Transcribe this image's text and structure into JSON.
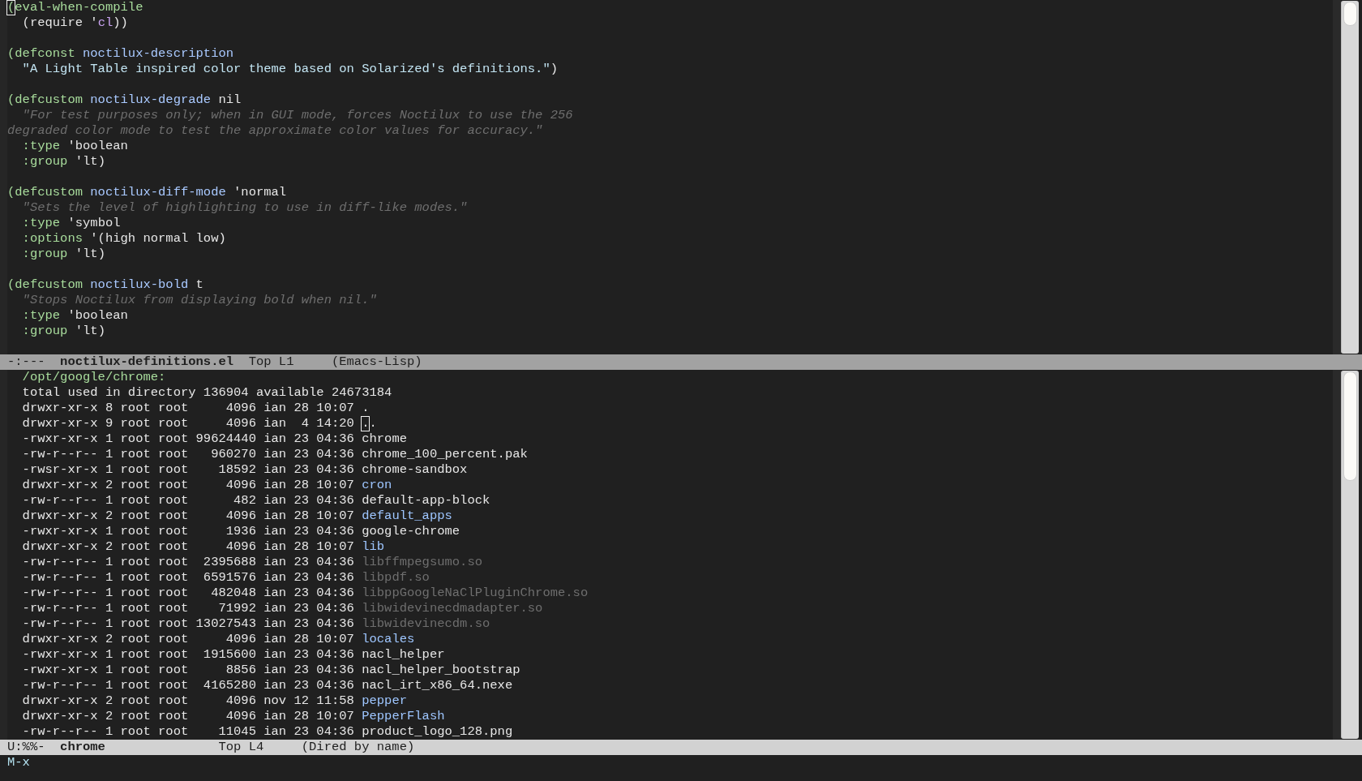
{
  "code_window": {
    "lines": [
      {
        "segments": [
          {
            "kind": "keyword",
            "text": "(eval-when-compile",
            "cursor": true
          }
        ]
      },
      {
        "segments": [
          {
            "kind": "plain",
            "text": "  (require '"
          },
          {
            "kind": "symbol",
            "text": "cl"
          },
          {
            "kind": "plain",
            "text": "))"
          }
        ]
      },
      {
        "blank_before": true,
        "segments": [
          {
            "kind": "keyword",
            "text": "(defconst"
          },
          {
            "kind": "name",
            "text": " noctilux-description"
          }
        ]
      },
      {
        "segments": [
          {
            "kind": "string",
            "text": "  \"A Light Table inspired color theme based on Solarized's definitions.\""
          },
          {
            "kind": "plain",
            "text": ")"
          }
        ]
      },
      {
        "blank_before": true,
        "segments": [
          {
            "kind": "keyword",
            "text": "(defcustom"
          },
          {
            "kind": "name",
            "text": " noctilux-degrade"
          },
          {
            "kind": "plain",
            "text": " nil"
          }
        ]
      },
      {
        "segments": [
          {
            "kind": "doc",
            "text": "  \"For test purposes only; when in GUI mode, forces Noctilux to use the 256"
          }
        ]
      },
      {
        "segments": [
          {
            "kind": "doc",
            "text": "degraded color mode to test the approximate color values for accuracy.\""
          }
        ]
      },
      {
        "segments": [
          {
            "kind": "keyword",
            "text": "  :type"
          },
          {
            "kind": "plain",
            "text": " 'boolean"
          }
        ]
      },
      {
        "segments": [
          {
            "kind": "keyword",
            "text": "  :group"
          },
          {
            "kind": "plain",
            "text": " 'lt)"
          }
        ]
      },
      {
        "blank_before": true,
        "segments": [
          {
            "kind": "keyword",
            "text": "(defcustom"
          },
          {
            "kind": "name",
            "text": " noctilux-diff-mode"
          },
          {
            "kind": "plain",
            "text": " 'normal"
          }
        ]
      },
      {
        "segments": [
          {
            "kind": "doc",
            "text": "  \"Sets the level of highlighting to use in diff-like modes.\""
          }
        ]
      },
      {
        "segments": [
          {
            "kind": "keyword",
            "text": "  :type"
          },
          {
            "kind": "plain",
            "text": " 'symbol"
          }
        ]
      },
      {
        "segments": [
          {
            "kind": "keyword",
            "text": "  :options"
          },
          {
            "kind": "plain",
            "text": " '(high normal low)"
          }
        ]
      },
      {
        "segments": [
          {
            "kind": "keyword",
            "text": "  :group"
          },
          {
            "kind": "plain",
            "text": " 'lt)"
          }
        ]
      },
      {
        "blank_before": true,
        "segments": [
          {
            "kind": "keyword",
            "text": "(defcustom"
          },
          {
            "kind": "name",
            "text": " noctilux-bold"
          },
          {
            "kind": "plain",
            "text": " t"
          }
        ]
      },
      {
        "segments": [
          {
            "kind": "doc",
            "text": "  \"Stops Noctilux from displaying bold when nil.\""
          }
        ]
      },
      {
        "segments": [
          {
            "kind": "keyword",
            "text": "  :type"
          },
          {
            "kind": "plain",
            "text": " 'boolean"
          }
        ]
      },
      {
        "segments": [
          {
            "kind": "keyword",
            "text": "  :group"
          },
          {
            "kind": "plain",
            "text": " 'lt)"
          }
        ]
      }
    ],
    "mode_line": {
      "active": false,
      "status": "-:---",
      "buffer": "noctilux-definitions.el",
      "position": "Top L1",
      "mode": "(Emacs-Lisp)"
    }
  },
  "dired_window": {
    "header": "  /opt/google/chrome:",
    "total": "  total used in directory 136904 available 24673184",
    "rows": [
      {
        "info": "  drwxr-xr-x 8 root root     4096 ian 28 10:07 ",
        "name": ".",
        "kind": "file"
      },
      {
        "info": "  drwxr-xr-x 9 root root     4096 ian  4 14:20 ",
        "name": "..",
        "kind": "file",
        "cursor": true
      },
      {
        "info": "  -rwxr-xr-x 1 root root 99624440 ian 23 04:36 ",
        "name": "chrome",
        "kind": "file"
      },
      {
        "info": "  -rw-r--r-- 1 root root   960270 ian 23 04:36 ",
        "name": "chrome_100_percent.pak",
        "kind": "file"
      },
      {
        "info": "  -rwsr-xr-x 1 root root    18592 ian 23 04:36 ",
        "name": "chrome-sandbox",
        "kind": "file"
      },
      {
        "info": "  drwxr-xr-x 2 root root     4096 ian 28 10:07 ",
        "name": "cron",
        "kind": "dir"
      },
      {
        "info": "  -rw-r--r-- 1 root root      482 ian 23 04:36 ",
        "name": "default-app-block",
        "kind": "file"
      },
      {
        "info": "  drwxr-xr-x 2 root root     4096 ian 28 10:07 ",
        "name": "default_apps",
        "kind": "dir"
      },
      {
        "info": "  -rwxr-xr-x 1 root root     1936 ian 23 04:36 ",
        "name": "google-chrome",
        "kind": "file"
      },
      {
        "info": "  drwxr-xr-x 2 root root     4096 ian 28 10:07 ",
        "name": "lib",
        "kind": "dir"
      },
      {
        "info": "  -rw-r--r-- 1 root root  2395688 ian 23 04:36 ",
        "name": "libffmpegsumo.so",
        "kind": "lib"
      },
      {
        "info": "  -rw-r--r-- 1 root root  6591576 ian 23 04:36 ",
        "name": "libpdf.so",
        "kind": "lib"
      },
      {
        "info": "  -rw-r--r-- 1 root root   482048 ian 23 04:36 ",
        "name": "libppGoogleNaClPluginChrome.so",
        "kind": "lib"
      },
      {
        "info": "  -rw-r--r-- 1 root root    71992 ian 23 04:36 ",
        "name": "libwidevinecdmadapter.so",
        "kind": "lib"
      },
      {
        "info": "  -rw-r--r-- 1 root root 13027543 ian 23 04:36 ",
        "name": "libwidevinecdm.so",
        "kind": "lib"
      },
      {
        "info": "  drwxr-xr-x 2 root root     4096 ian 28 10:07 ",
        "name": "locales",
        "kind": "dir"
      },
      {
        "info": "  -rwxr-xr-x 1 root root  1915600 ian 23 04:36 ",
        "name": "nacl_helper",
        "kind": "file"
      },
      {
        "info": "  -rwxr-xr-x 1 root root     8856 ian 23 04:36 ",
        "name": "nacl_helper_bootstrap",
        "kind": "file"
      },
      {
        "info": "  -rw-r--r-- 1 root root  4165280 ian 23 04:36 ",
        "name": "nacl_irt_x86_64.nexe",
        "kind": "file"
      },
      {
        "info": "  drwxr-xr-x 2 root root     4096 nov 12 11:58 ",
        "name": "pepper",
        "kind": "dir"
      },
      {
        "info": "  drwxr-xr-x 2 root root     4096 ian 28 10:07 ",
        "name": "PepperFlash",
        "kind": "dir"
      },
      {
        "info": "  -rw-r--r-- 1 root root    11045 ian 23 04:36 ",
        "name": "product_logo_128.png",
        "kind": "file"
      }
    ],
    "mode_line": {
      "active": true,
      "status": "U:%%-",
      "buffer": "chrome",
      "position": "Top L4",
      "mode": "(Dired by name)"
    }
  },
  "minibuffer": {
    "prompt": "M-x"
  }
}
